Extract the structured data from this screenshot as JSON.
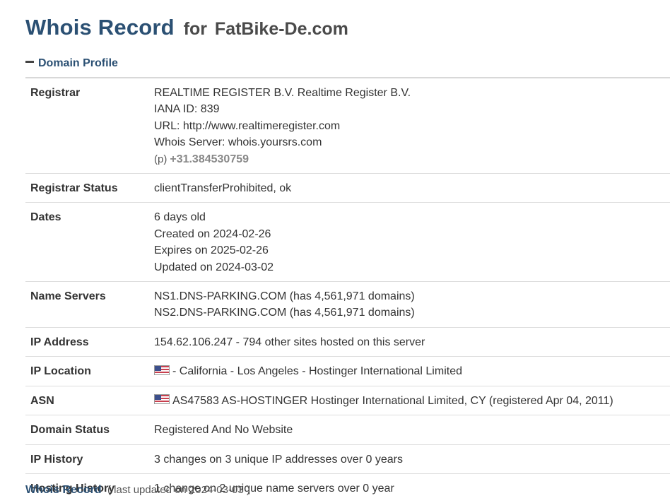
{
  "header": {
    "title": "Whois Record",
    "for_word": "for",
    "domain": "FatBike-De.com"
  },
  "section": {
    "label": "Domain Profile",
    "icon": "minus-icon"
  },
  "profile": {
    "registrar": {
      "label": "Registrar",
      "name": "REALTIME REGISTER B.V. Realtime Register B.V.",
      "iana": "IANA ID: 839",
      "url": "URL: http://www.realtimeregister.com",
      "whois_server": "Whois Server: whois.yoursrs.com",
      "phone_prefix": "(p)",
      "phone": "+31.384530759"
    },
    "registrar_status": {
      "label": "Registrar Status",
      "value": "clientTransferProhibited, ok"
    },
    "dates": {
      "label": "Dates",
      "age": "6 days old",
      "created": "Created on 2024-02-26",
      "expires": "Expires on 2025-02-26",
      "updated": "Updated on 2024-03-02"
    },
    "name_servers": {
      "label": "Name Servers",
      "ns1": "NS1.DNS-PARKING.COM (has 4,561,971 domains)",
      "ns2": "NS2.DNS-PARKING.COM (has 4,561,971 domains)"
    },
    "ip_address": {
      "label": "IP Address",
      "value": "154.62.106.247 - 794 other sites hosted on this server"
    },
    "ip_location": {
      "label": "IP Location",
      "value": "- California - Los Angeles - Hostinger International Limited",
      "flag": "us-flag-icon"
    },
    "asn": {
      "label": "ASN",
      "value": "AS47583 AS-HOSTINGER Hostinger International Limited, CY (registered Apr 04, 2011)",
      "flag": "us-flag-icon"
    },
    "domain_status": {
      "label": "Domain Status",
      "value": "Registered And No Website"
    },
    "ip_history": {
      "label": "IP History",
      "value": "3 changes on 3 unique IP addresses over 0 years"
    },
    "hosting_history": {
      "label": "Hosting History",
      "value": "1 change on 2 unique name servers over 0 year"
    }
  },
  "footer": {
    "label": "Whois Record",
    "updated": "( last updated on 2024-03-03 )"
  },
  "colors": {
    "heading": "#2b5073",
    "text": "#333333",
    "phone": "#888888",
    "divider": "#dddddd"
  }
}
